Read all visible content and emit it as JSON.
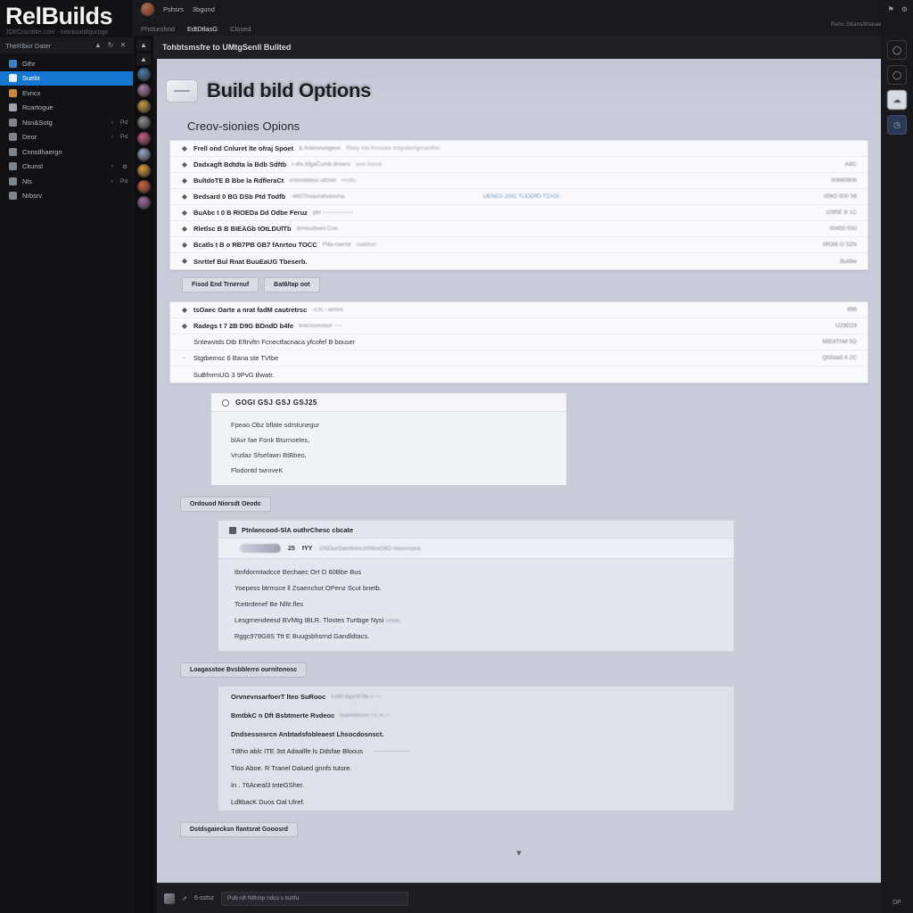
{
  "sidebar": {
    "brand_title": "RelBuilds",
    "brand_subtitle": "JOf/Cnsrdtlle.com - bitinbuxldfgurpge",
    "header_title": "TheRlbor Dater",
    "header_icons": [
      "chevron-up-icon",
      "refresh-icon",
      "close-icon"
    ],
    "items": [
      {
        "label": "Gthr",
        "icon_color": "#3b7fc4",
        "chevron": "",
        "badge": "",
        "active": false
      },
      {
        "label": "Suebt",
        "icon_color": "#e8eef6",
        "chevron": "",
        "badge": "",
        "active": true
      },
      {
        "label": "Evncx",
        "icon_color": "#c98b3a",
        "chevron": "",
        "badge": "",
        "active": false
      },
      {
        "label": "Rcartogue",
        "icon_color": "#9ea4ae",
        "chevron": "",
        "badge": "",
        "active": false
      },
      {
        "label": "Nsn&Sotg",
        "icon_color": "#7e838d",
        "chevron": "›",
        "badge": "Pd",
        "active": false
      },
      {
        "label": "Deor",
        "icon_color": "#7e838d",
        "chevron": "›",
        "badge": "Pd",
        "active": false
      },
      {
        "label": "Cnnstlhaergn",
        "icon_color": "#7e838d",
        "chevron": "",
        "badge": "",
        "active": false
      },
      {
        "label": "Ckunsl",
        "icon_color": "#7e838d",
        "chevron": "›",
        "badge": "⚙",
        "active": false
      },
      {
        "label": "Nls",
        "icon_color": "#7e838d",
        "chevron": "›",
        "badge": "Pd",
        "active": false
      },
      {
        "label": "Nrbsrv",
        "icon_color": "#7e838d",
        "chevron": "",
        "badge": "",
        "active": false
      }
    ]
  },
  "rail": {
    "controls": [
      "chevron-up-icon",
      "chevron-up-icon"
    ],
    "avatars": [
      "#4c7fa8",
      "#a87fa0",
      "#c79a3e",
      "#8e8e8e",
      "#c75c86",
      "#9aa8c0",
      "#d89a3a",
      "#d2663a",
      "#a06f9e"
    ]
  },
  "topbar": {
    "account_link": "Pshsrs",
    "secondary_link": "3bgund",
    "icons": [
      "flag-icon",
      "gear-icon"
    ],
    "right_note": "Rehs Sttans/thsnae Tneboag",
    "tabs": [
      {
        "label": "Phsturshnd",
        "active": false
      },
      {
        "label": "EdtDtlasG",
        "active": true
      },
      {
        "label": "Closed",
        "active": false
      }
    ]
  },
  "subheader": {
    "title": "Tohbtsmsfre to UMtgSenll Bullted"
  },
  "hero": {
    "icon": "build-box-icon",
    "title": "Build bild Options"
  },
  "main": {
    "section_title": "Creov-sionies Opions",
    "card1": {
      "header": {
        "bullet": "◆",
        "main": "Frell ond Cnluret lte ofraj Spoet",
        "sub": "& Anbrwsmgeon",
        "sub2": "Rtely me Ancoaie trdgulteAgmanihm"
      },
      "rows": [
        {
          "bullet": "◆",
          "main": "Dadxagft  Bdtdta la Bdb Sdftb",
          "sub": "r-dts bfgaCumb dvsers",
          "sub2": "aws tsnne",
          "link": "",
          "value": "ABC"
        },
        {
          "bullet": "◆",
          "main": "BultdoTE B Bbe la RdfleraCt",
          "sub": "ontsvddeuc uttzeb",
          "sub2": "mrdtu",
          "link": "",
          "value": "00660906"
        },
        {
          "bullet": "◆",
          "main": "Bedsard 0 BG DSb Ptd Todfb",
          "sub": "-4tt07hoauratsonuna",
          "sub2": "",
          "link": "UENES 20IC TUOGfO TZASI ·",
          "value": "00K0 500 56"
        },
        {
          "bullet": "◆",
          "main": "BuAbc t 0 B RIOEDa Dd Odbe Feruz",
          "sub": "pbr ~-~-~-~-~-~",
          "sub2": "",
          "link": "",
          "value": "1095E B 1C"
        },
        {
          "bullet": "◆",
          "main": "Rletlsc B B BIEAGb tOtLDUlTb",
          "sub": "drmsudoen Cce.",
          "sub2": "",
          "link": "",
          "value": "00450 550"
        },
        {
          "bullet": "◆",
          "main": "Bcatls t B o RB7PB GB7 fAnrtou TOCC",
          "sub": "Pda-ctarnd",
          "sub2": "ctatbton",
          "link": "",
          "value": "0R3I6 G 5ZN"
        },
        {
          "bullet": "◆",
          "main": "Snrttef Bul Rnat BuuEaUG Tbeserb.",
          "sub": "",
          "sub2": "",
          "link": "",
          "value": "Buttbe"
        }
      ]
    },
    "buttons": [
      {
        "label": "Fisod End Trnernuf"
      },
      {
        "label": "Bat6/tap oot"
      }
    ],
    "card2": {
      "rows": [
        {
          "bullet": "◆",
          "main": "tsOaec Oarte a nrat fadM cautretrsc",
          "sub": "-c.tc.-.wmns",
          "value": "996"
        },
        {
          "bullet": "◆",
          "main": "Radegs t 7 2B D9G BDndD b4fe",
          "sub": "tnacrousnoul ~-~",
          "value": "U29D29"
        },
        {
          "bullet": "",
          "main": "",
          "plain": "Sntewvtds Dtb Eftrvftn Fcnectfacnaca yfcofef B bouser",
          "value": "MtE9ThM 5G"
        },
        {
          "bullet": "·",
          "main": "",
          "plain": "Stgtbemsc 6 Bana ste TVtbe",
          "value": "Q00da5 6 2C"
        },
        {
          "bullet": "",
          "main": "",
          "plain": "SuBfnrmUG 3 9PvG Bwatr.",
          "value": ""
        }
      ]
    },
    "panel": {
      "radio": "radio-unselected",
      "header": "GOGI GSJ GSJ GSJ25",
      "lines": [
        "Fpeao Obz bflate sdrstunegur",
        "blAvr fae Fonk Bturnoeles,",
        "Vrutlaz Sfsefawn BtBbeo,",
        "Flodontd twroveK"
      ]
    },
    "panel_button": {
      "label": "Ordouod Niorsdt Oeodc"
    },
    "card3": {
      "header": {
        "icon": "flag-icon",
        "text": "Ptnlancood-SlA outhrChesc cbcate"
      },
      "sub": {
        "image": "chip-image",
        "t1": "25",
        "t2": "fYY",
        "desc": "GNDurGanrtnen.tVt4nxO6D mtuvroosa"
      },
      "lines": [
        {
          "text": "tbnfdormtadcce Bechaec Ort O 60Bbe Bus",
          "dim": ""
        },
        {
          "text": "Yoepess btrmsce ll Zsaenchot OPenz Scut bnetb.",
          "dim": ""
        },
        {
          "text": "Tcettrdenef Be Nlltr.fles",
          "dim": ""
        },
        {
          "text": "Lesgrnendeesd BVMtg IBLR. Tlostes Turtbge Nysi",
          "dim": "cntee."
        },
        {
          "text": "Rggc979G8S Ttt E Buugsbhsrnd Gandldtacs.",
          "dim": ""
        }
      ]
    },
    "card3_button": {
      "label": "Loagasstoe Bvsbblerro ournitonosc"
    },
    "card4": {
      "lines": [
        {
          "text": "OrvnevnsarfoerT lteo SuRooc",
          "dim": "fuhkl bgsrtP.fte.i~~~",
          "head": true,
          "rule": false
        },
        {
          "text": "BmtbkC n Dft Bsbtmerte Rvdeoc",
          "dim": "tbanetbnorr  t-t.-rt.-~",
          "head": true,
          "rule": false
        },
        {
          "text": "Dndsessnsrcn Anbtadsfobleaest Lhsocdosnsct.",
          "dim": "",
          "head": true,
          "rule": false
        },
        {
          "text": "Tdtho ablc ITE  3st Adaallfe ls  Ddsfae Bloous",
          "dim": "",
          "head": false,
          "rule": true
        },
        {
          "text": "Tloo Aboe. R Tranel Dalued gnnfs tutsre.",
          "dim": "",
          "head": false,
          "rule": false
        },
        {
          "text": "In . 76Aneal3 tnteGSher.",
          "dim": "",
          "head": false,
          "rule": false
        },
        {
          "text": "LdltbacK Duos Oal Ulref.",
          "dim": "",
          "head": false,
          "rule": false
        }
      ]
    },
    "card4_button": {
      "label": "Dstdsgaiecksn flantsrat Gooosrd"
    },
    "scroll_icon": "chevron-down-icon"
  },
  "bottombar": {
    "avatar": "user-avatar",
    "icon": "arrow-icon",
    "label": "6-sstsz",
    "input_value": "Pub rdt Ntfrmp ndcs s tsztfu"
  },
  "rightrail": {
    "icons": [
      "flag-icon",
      "gear-icon"
    ],
    "buttons": [
      "circle-icon",
      "circle-icon",
      "cloud-icon",
      "clock-icon"
    ],
    "bottom_label": "DP"
  },
  "colors": {
    "accent": "#1576d1",
    "content_bg": "#c9cbd9",
    "card_bg": "#fafafc",
    "link": "#6d92c4"
  }
}
